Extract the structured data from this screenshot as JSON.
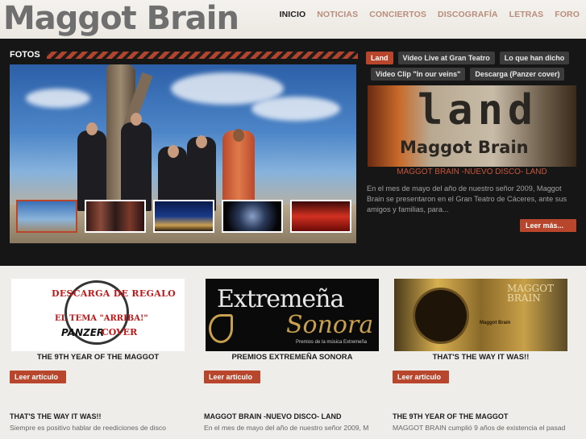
{
  "logo": "Maggot Brain",
  "nav": [
    "INICIO",
    "NOTICIAS",
    "CONCIERTOS",
    "DISCOGRAFÍA",
    "LETRAS",
    "FORO"
  ],
  "gallery": {
    "title": "FOTOS"
  },
  "tabs": [
    "Land",
    "Video Live at Gran Teatro",
    "Lo que han dicho",
    "Video Clip \"In our veins\"",
    "Descarga (Panzer cover)"
  ],
  "featured": {
    "album_word": "land",
    "album_band": "Maggot Brain",
    "title": "MAGGOT BRAIN -NUEVO DISCO- LAND",
    "body": "En el mes de mayo del año de nuestro señor 2009, Maggot Brain se presentaron  en el Gran Teatro de Cáceres, ante sus amigos y familias, para...",
    "more_label": "Leer más..."
  },
  "cards": [
    {
      "caption": "THE 9TH YEAR OF THE MAGGOT",
      "button": "Leer artículo",
      "title2": "THAT'S THE WAY IT WAS!!",
      "text2": "Siempre es positivo hablar de reediciones de disco",
      "art": {
        "line1": "DESCARGA DE REGALO",
        "line2": "EL TEMA \"ARRIBA!\"",
        "panzer": "PANZER",
        "cover": "COVER"
      }
    },
    {
      "caption": "PREMIOS EXTREMEÑA SONORA",
      "button": "Leer artículo",
      "title2": "MAGGOT BRAIN -NUEVO DISCO- LAND",
      "text2": "En el mes de mayo del año de nuestro señor 2009, M",
      "art": {
        "line1": "Extremeña",
        "line2": "Sonora",
        "line3": "Premios de la música Extremeña"
      }
    },
    {
      "caption": "THAT'S THE WAY IT WAS!!",
      "button": "Leer artículo",
      "title2": "THE 9TH YEAR OF THE MAGGOT",
      "text2": "MAGGOT BRAIN cumplió 9 años de existencia el pasad",
      "art": {
        "line1": "MAGGOT",
        "line2": "BRAIN",
        "small": "Maggot Brain"
      }
    }
  ]
}
